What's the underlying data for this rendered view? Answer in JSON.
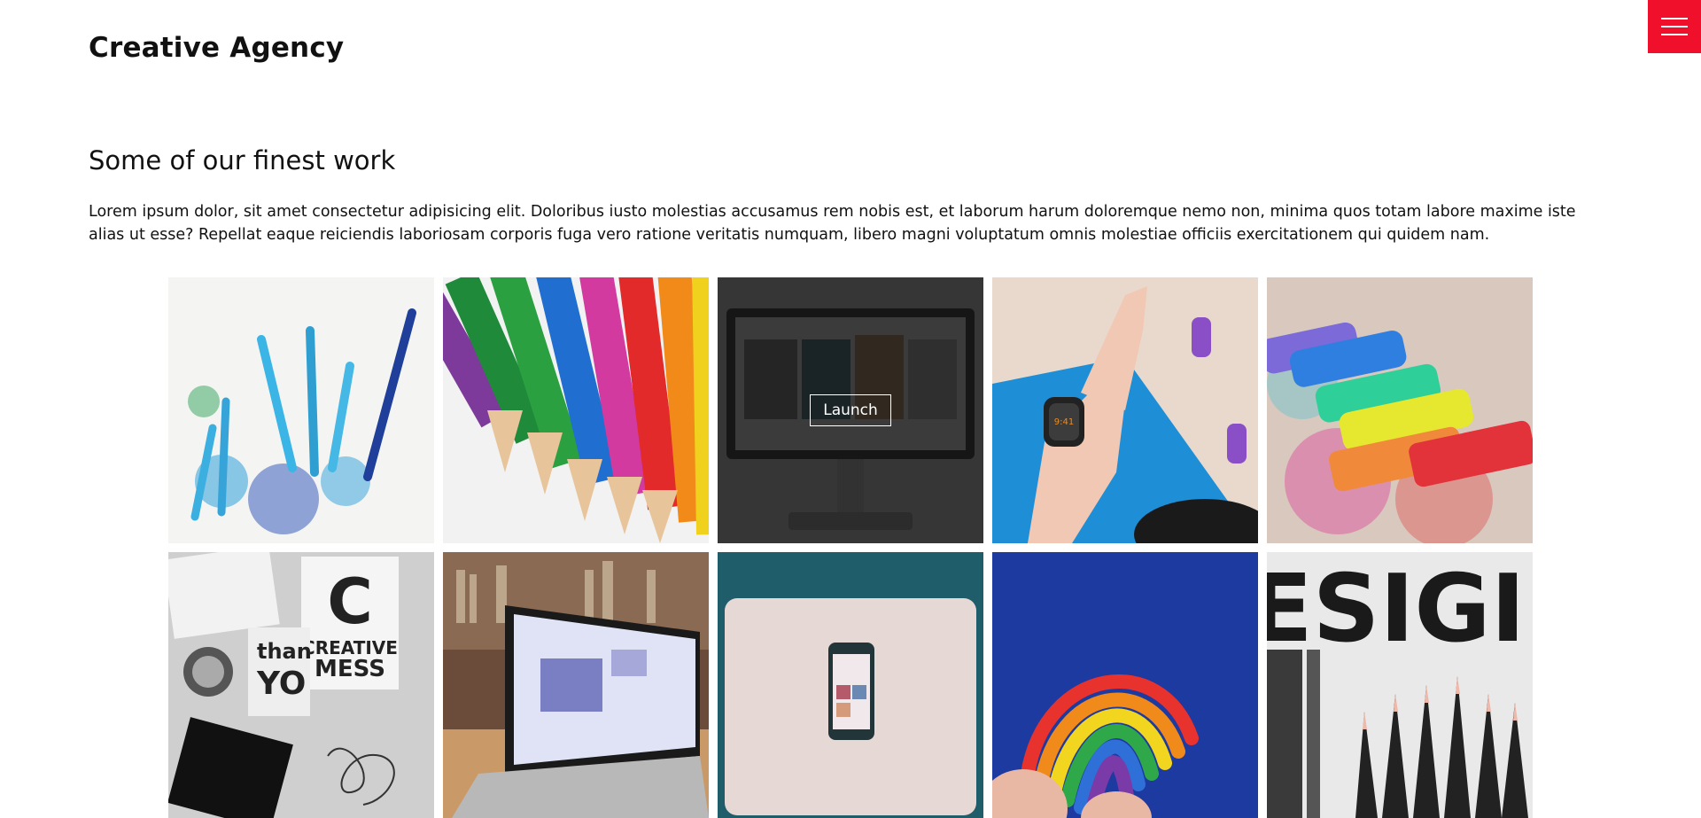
{
  "header": {
    "logo": "Creative Agency",
    "menu_icon": "hamburger-menu-icon",
    "accent_color": "#f0102b"
  },
  "work": {
    "title": "Some of our finest work",
    "description": "Lorem ipsum dolor, sit amet consectetur adipisicing elit. Doloribus iusto molestias accusamus rem nobis est, et laborum harum doloremque nemo non, minima quos totam labore maxime iste alias ut esse? Repellat eaque reiciendis laboriosam corporis fuga vero ratione veritatis numquam, libero magni voluptatum omnis molestiae officiis exercitationem qui quidem nam.",
    "launch_label": "Launch",
    "tiles": [
      {
        "subject": "blue pencils with shavings"
      },
      {
        "subject": "colored pencil tips"
      },
      {
        "subject": "desktop monitor with gallery site",
        "hovered": true
      },
      {
        "subject": "hand with smartwatch and dumbbells"
      },
      {
        "subject": "colorful chalk pieces"
      },
      {
        "subject": "creative mess black and white papers"
      },
      {
        "subject": "laptop on wooden desk"
      },
      {
        "subject": "laptop and smartphone on teal"
      },
      {
        "subject": "rainbow clay in hand on blue"
      },
      {
        "subject": "design poster with black pencils"
      }
    ]
  }
}
